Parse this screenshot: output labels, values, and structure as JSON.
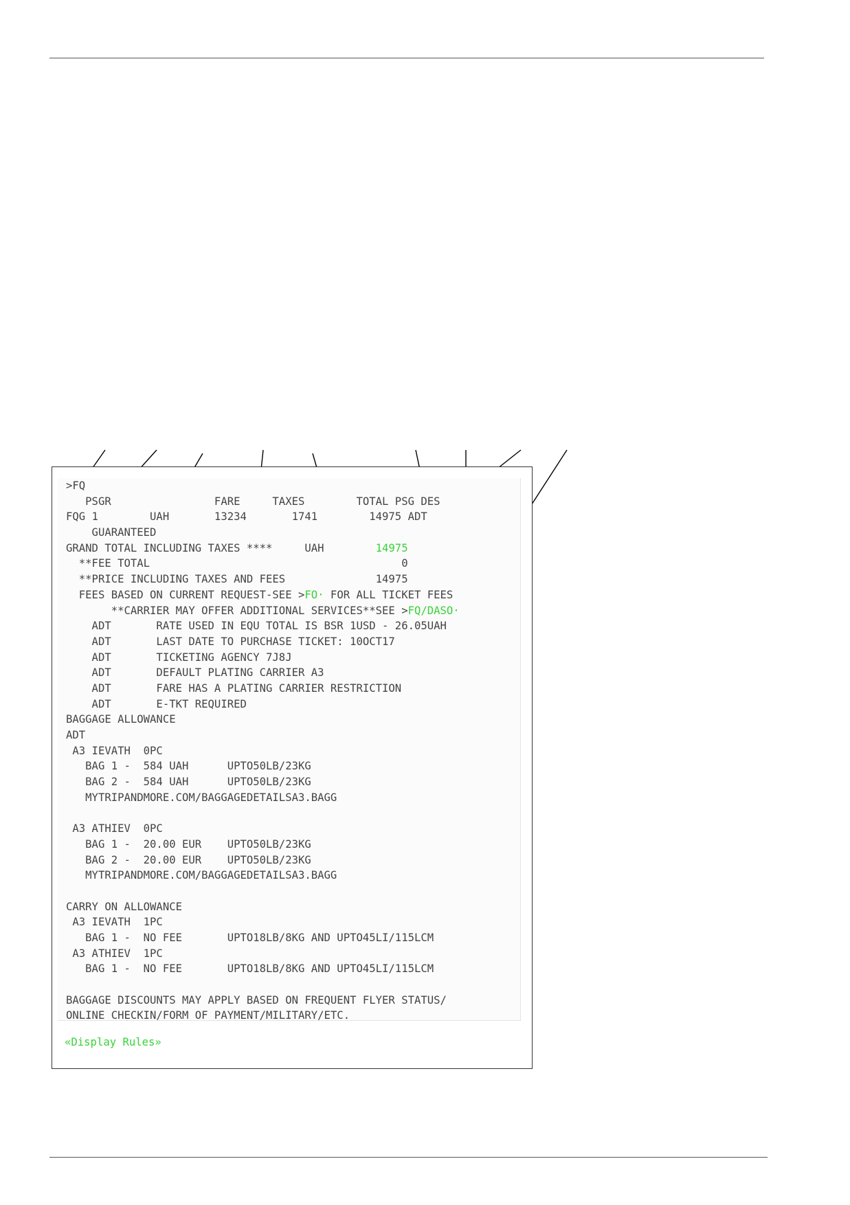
{
  "terminal": {
    "lines": [
      ">FQ",
      "   PSGR                FARE     TAXES        TOTAL PSG DES",
      "FQG 1        UAH       13234       1741        14975 ADT",
      "    GUARANTEED",
      "GRAND TOTAL INCLUDING TAXES ****     UAH        |14975|",
      "  **FEE TOTAL                                       0",
      "  **PRICE INCLUDING TAXES AND FEES              14975",
      "  FEES BASED ON CURRENT REQUEST-SEE >|FO·| FOR ALL TICKET FEES",
      "       **CARRIER MAY OFFER ADDITIONAL SERVICES**SEE >|FQ/DASO·|",
      "    ADT       RATE USED IN EQU TOTAL IS BSR 1USD - 26.05UAH",
      "    ADT       LAST DATE TO PURCHASE TICKET: 10OCT17",
      "    ADT       TICKETING AGENCY 7J8J",
      "    ADT       DEFAULT PLATING CARRIER A3",
      "    ADT       FARE HAS A PLATING CARRIER RESTRICTION",
      "    ADT       E-TKT REQUIRED",
      "BAGGAGE ALLOWANCE",
      "ADT",
      " A3 IEVATH  0PC",
      "   BAG 1 -  584 UAH      UPTO50LB/23KG",
      "   BAG 2 -  584 UAH      UPTO50LB/23KG",
      "   MYTRIPANDMORE.COM/BAGGAGEDETAILSA3.BAGG",
      "",
      " A3 ATHIEV  0PC",
      "   BAG 1 -  20.00 EUR    UPTO50LB/23KG",
      "   BAG 2 -  20.00 EUR    UPTO50LB/23KG",
      "   MYTRIPANDMORE.COM/BAGGAGEDETAILSA3.BAGG",
      "",
      "CARRY ON ALLOWANCE",
      " A3 IEVATH  1PC",
      "   BAG 1 -  NO FEE       UPTO18LB/8KG AND UPTO45LI/115LCM",
      " A3 ATHIEV  1PC",
      "   BAG 1 -  NO FEE       UPTO18LB/8KG AND UPTO45LI/115LCM",
      "",
      "BAGGAGE DISCOUNTS MAY APPLY BASED ON FREQUENT FLYER STATUS/",
      "ONLINE CHECKIN/FORM OF PAYMENT/MILITARY/ETC."
    ],
    "display_rules_label": "«Display Rules»"
  },
  "colors": {
    "terminal_text": "#444444",
    "highlight_green": "#39d239",
    "rule_line": "#555555",
    "callout_line": "#000000"
  }
}
